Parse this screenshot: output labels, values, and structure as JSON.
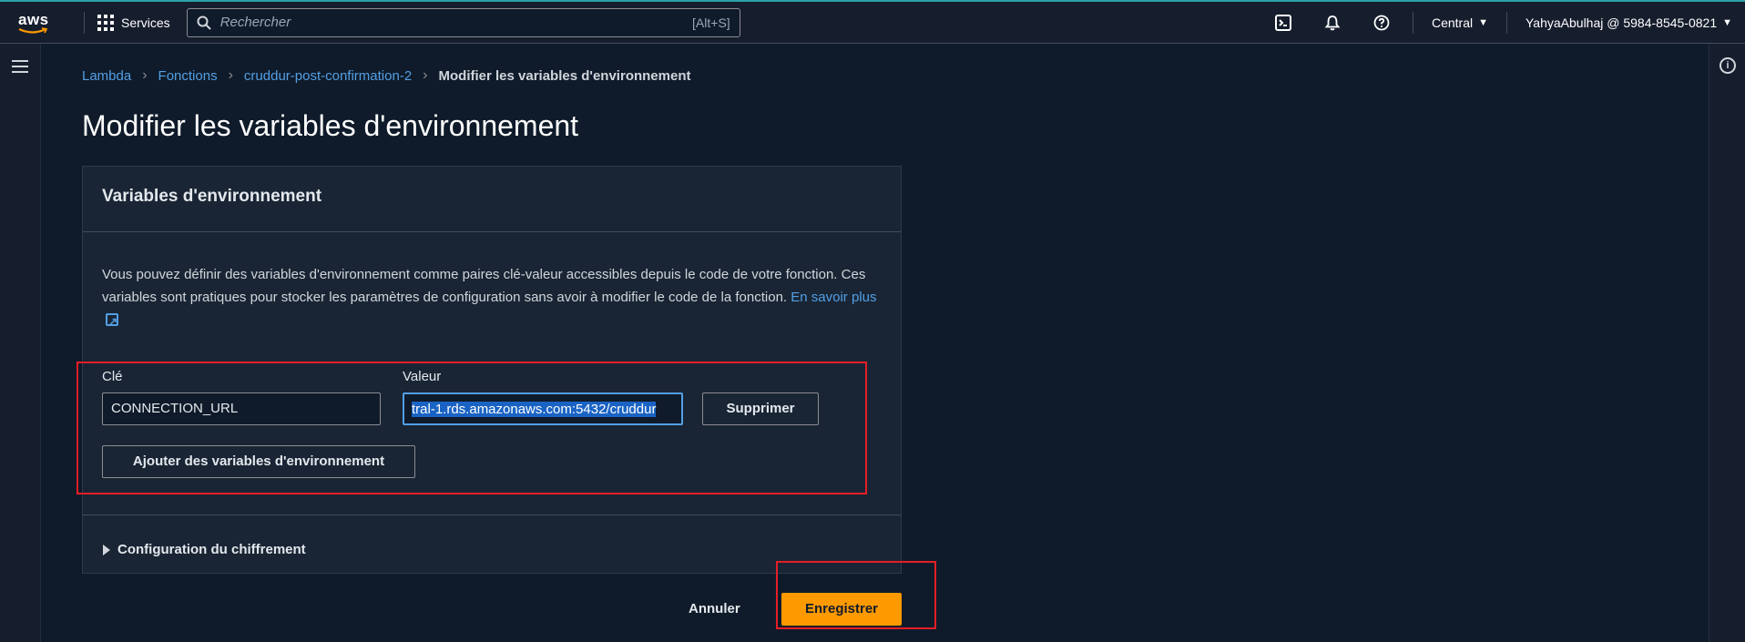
{
  "header": {
    "logo_text": "aws",
    "services_label": "Services",
    "search_placeholder": "Rechercher",
    "search_shortcut": "[Alt+S]",
    "region": "Central",
    "account": "YahyaAbulhaj @ 5984-8545-0821",
    "icons": [
      "cloudshell-icon",
      "bell-icon",
      "help-icon"
    ]
  },
  "breadcrumb": [
    {
      "label": "Lambda"
    },
    {
      "label": "Fonctions"
    },
    {
      "label": "cruddur-post-confirmation-2"
    },
    {
      "label": "Modifier les variables d'environnement"
    }
  ],
  "page": {
    "title": "Modifier les variables d'environnement"
  },
  "panel": {
    "title": "Variables d'environnement",
    "description": "Vous pouvez définir des variables d'environnement comme paires clé-valeur accessibles depuis le code de votre fonction. Ces variables sont pratiques pour stocker les paramètres de configuration sans avoir à modifier le code de la fonction.",
    "learn_more": "En savoir plus",
    "key_label": "Clé",
    "value_label": "Valeur",
    "variables": [
      {
        "key": "CONNECTION_URL",
        "value": "tral-1.rds.amazonaws.com:5432/cruddur"
      }
    ],
    "remove_button": "Supprimer",
    "add_button": "Ajouter des variables d'environnement",
    "encryption_label": "Configuration du chiffrement"
  },
  "footer": {
    "cancel": "Annuler",
    "save": "Enregistrer"
  },
  "colors": {
    "primary_button": "#ff9900",
    "link": "#539fe5",
    "annotation_red": "#e51e25"
  }
}
